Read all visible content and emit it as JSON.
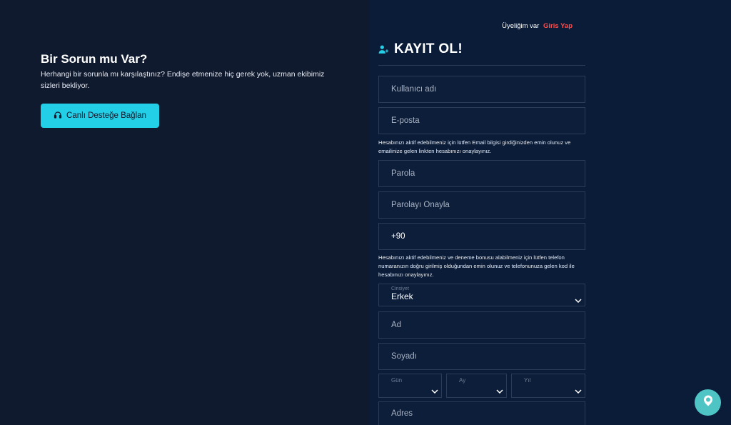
{
  "help": {
    "title": "Bir Sorun mu Var?",
    "text": "Herhangi bir sorunla mı karşılaştınız? Endişe etmenize hiç gerek yok, uzman ekibimiz sizleri bekliyor.",
    "button_label": "Canlı Desteğe Bağlan"
  },
  "auth": {
    "member_text": "Üyeliğim var",
    "login_link": "Giris Yap"
  },
  "register": {
    "title": "KAYIT OL!",
    "username_placeholder": "Kullanıcı adı",
    "email_placeholder": "E-posta",
    "email_info": "Hesabınızı aktif edebilmeniz için lütfen Email bilgisi girdiğinizden emin olunuz ve emailinize gelen linkten hesabınızı onaylayınız.",
    "password_placeholder": "Parola",
    "password_confirm_placeholder": "Parolayı Onayla",
    "phone_value": "+90",
    "phone_info": "Hesabınızı aktif edebilmeniz ve deneme bonusu alabilmeniz için lütfen telefon numaranızın doğru girilmiş olduğundan emin olunuz ve telefonunuza gelen kod ile hesabınızı onaylayınız.",
    "gender_label": "Cinsiyet",
    "gender_value": "Erkek",
    "name_placeholder": "Ad",
    "surname_placeholder": "Soyadı",
    "day_label": "Gün",
    "month_label": "Ay",
    "year_label": "Yıl",
    "address_placeholder": "Adres"
  },
  "colors": {
    "accent": "#22cfe6",
    "login_link": "#ff4b4b",
    "chat_bubble": "#4fc4c4"
  }
}
